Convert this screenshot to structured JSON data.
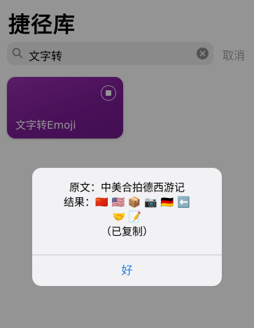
{
  "header": {
    "title": "捷径库"
  },
  "search": {
    "value": "文字转",
    "cancel_label": "取消"
  },
  "shortcut_card": {
    "label": "文字转Emoji",
    "color": "#8a26a6"
  },
  "alert": {
    "line1": "原文：中美合拍德西游记",
    "line2": "结果：🇨🇳 🇺🇸 📦 📷 🇩🇪 ⬅️",
    "line3": "🤝 📝",
    "line4": "（已复制）",
    "ok_label": "好"
  },
  "colors": {
    "accent": "#1f7ae0",
    "card": "#8a26a6"
  }
}
